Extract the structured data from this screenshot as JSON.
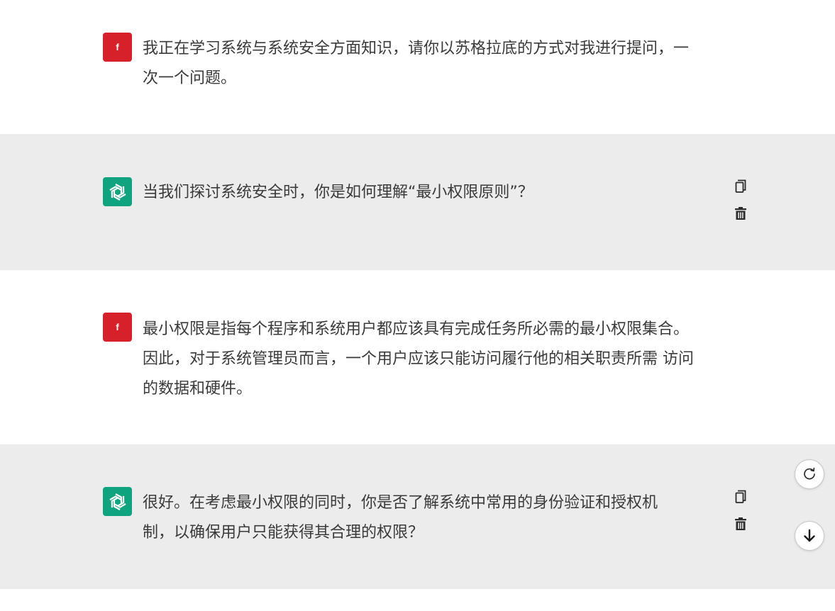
{
  "conversation": {
    "messages": [
      {
        "role": "user",
        "avatar_letter": "f",
        "lines": [
          "我正在学习系统与系统安全方面知识，请你以苏格拉底的方式对我进行提问，一",
          "次一个问题。"
        ]
      },
      {
        "role": "assistant",
        "lines": [
          "当我们探讨系统安全时，你是如何理解“最小权限原则”？"
        ]
      },
      {
        "role": "user",
        "avatar_letter": "f",
        "lines": [
          "最小权限是指每个程序和系统用户都应该具有完成任务所必需的最小权限集合。",
          "因此，对于系统管理员而言，一个用户应该只能访问履行他的相关职责所需 访问",
          "的数据和硬件。"
        ]
      },
      {
        "role": "assistant",
        "lines": [
          "很好。在考虑最小权限的同时，你是否了解系统中常用的身份验证和授权机",
          "制，以确保用户只能获得其合理的权限？"
        ]
      }
    ]
  },
  "icons": {
    "assistant_avatar": "openai-logo-icon",
    "copy": "copy-icon",
    "delete": "trash-icon",
    "regenerate": "refresh-icon",
    "scroll_down": "arrow-down-icon"
  },
  "colors": {
    "user_avatar_bg": "#d7212a",
    "assistant_avatar_bg": "#10a37f",
    "assistant_row_bg": "#ececec",
    "user_row_bg": "#ffffff",
    "text": "#3a3a3a"
  }
}
